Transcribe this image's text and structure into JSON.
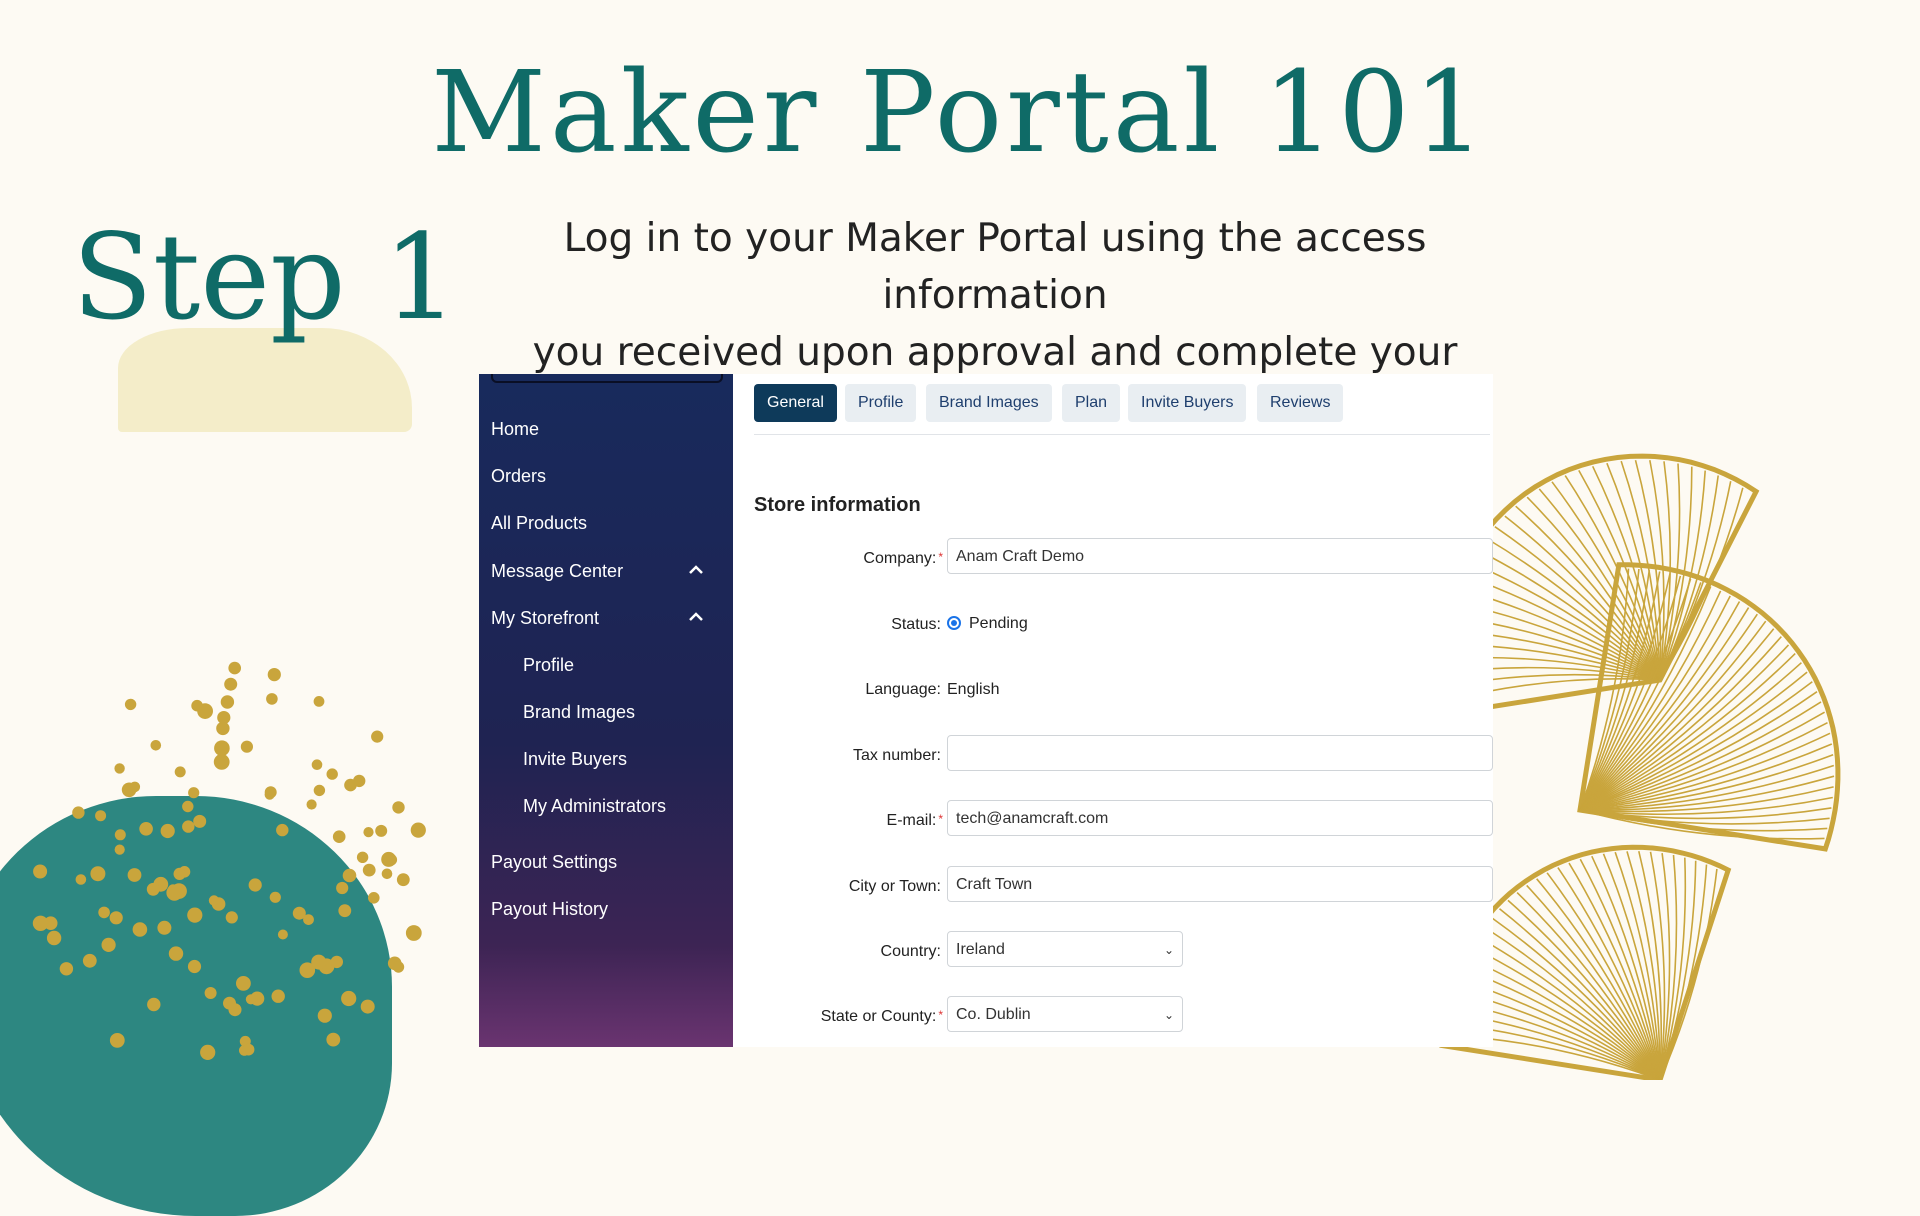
{
  "slide": {
    "title": "Maker Portal 101",
    "step": "Step 1",
    "subtitle_line1": "Log in to your Maker Portal using the access information",
    "subtitle_line2": "you received upon approval and complete your Profile"
  },
  "sidebar": {
    "items": [
      {
        "label": "Home"
      },
      {
        "label": "Orders"
      },
      {
        "label": "All Products"
      },
      {
        "label": "Message Center",
        "icon": "chevron-up-icon"
      },
      {
        "label": "My Storefront",
        "icon": "chevron-up-icon"
      },
      {
        "label": "Profile"
      },
      {
        "label": "Brand Images"
      },
      {
        "label": "Invite Buyers"
      },
      {
        "label": "My Administrators"
      },
      {
        "label": "Payout Settings"
      },
      {
        "label": "Payout History"
      }
    ]
  },
  "tabs": [
    {
      "label": "General",
      "active": true
    },
    {
      "label": "Profile"
    },
    {
      "label": "Brand Images"
    },
    {
      "label": "Plan"
    },
    {
      "label": "Invite Buyers"
    },
    {
      "label": "Reviews"
    }
  ],
  "form": {
    "heading": "Store information",
    "company_label": "Company:",
    "company_value": "Anam Craft Demo",
    "status_label": "Status:",
    "status_value": "Pending",
    "language_label": "Language:",
    "language_value": "English",
    "tax_label": "Tax number:",
    "tax_value": "",
    "email_label": "E-mail:",
    "email_value": "tech@anamcraft.com",
    "city_label": "City or Town:",
    "city_value": "Craft Town",
    "country_label": "Country:",
    "country_value": "Ireland",
    "state_label": "State or County:",
    "state_value": "Co. Dublin",
    "required_mark": "*"
  },
  "colors": {
    "accent": "#0f6b67",
    "sidebar": "#182a5c",
    "active_tab": "#0e3a5a",
    "gold": "#c9a53c",
    "blob": "#2d8781"
  }
}
